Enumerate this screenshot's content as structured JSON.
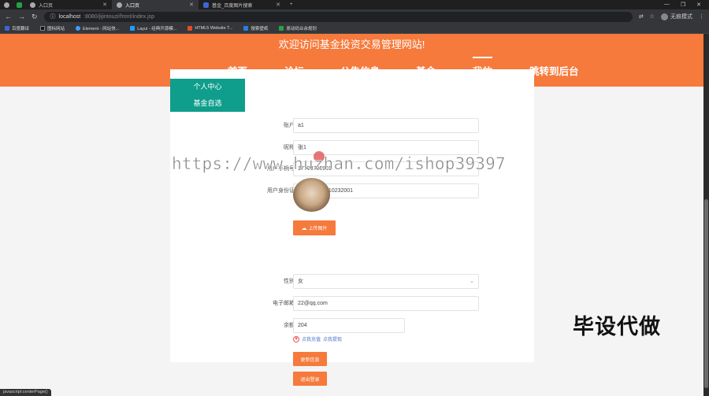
{
  "browser": {
    "tabs": [
      {
        "label": ""
      },
      {
        "label": ""
      },
      {
        "label": "入口页"
      },
      {
        "label": "入口页"
      },
      {
        "label": "基金_百度图片搜索"
      }
    ],
    "new_tab": "+",
    "url_host": "localhost",
    "url_rest": ":8080/jijintouzi/front/index.jsp",
    "profile_label": "无痕模式",
    "bookmarks": [
      "百度翻译",
      "图标网站",
      "Element - 网站快...",
      "Layui - 经典开源模...",
      "HTML5 Website T...",
      "搜索壁纸",
      "原动码业余规划"
    ]
  },
  "site": {
    "title": "欢迎访问基金投资交易管理网站!",
    "nav": [
      "首页",
      "论坛",
      "公告信息",
      "基金",
      "我的",
      "跳转到后台"
    ],
    "active_nav": "我的",
    "section_title": "个人中心"
  },
  "sidebar": {
    "items": [
      "个人中心",
      "基金自选"
    ]
  },
  "form": {
    "account_label": "账户",
    "account_value": "a1",
    "nickname_label": "昵称",
    "nickname_value": "张1",
    "phone_label": "用户手机号",
    "phone_value": "17703786901",
    "idcard_label": "用户身份证",
    "idcard_value": "410224199910232001",
    "upload_label": "上传图片",
    "gender_label": "性别",
    "gender_value": "女",
    "email_label": "电子邮箱",
    "email_value": "22@qq.com",
    "balance_label": "余额",
    "balance_value": "204",
    "recharge_text": "点我充值",
    "withdraw_text": "点我提现",
    "update_button": "更新信息",
    "logout_button": "退出登录"
  },
  "overlay": {
    "watermark": "https://www.huzhan.com/ishop39397",
    "brand": "毕设代做",
    "status": "javascript:centerPage()"
  },
  "colors": {
    "accent": "#f67a3c",
    "sidebar": "#0e9e8b"
  }
}
